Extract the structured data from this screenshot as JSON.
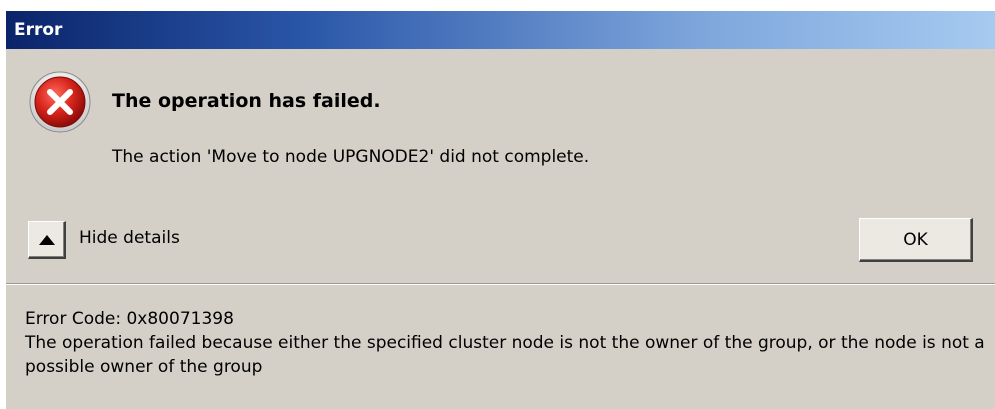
{
  "window": {
    "title": "Error"
  },
  "dialog": {
    "icon": "error-icon",
    "heading": "The operation has failed.",
    "message": "The action 'Move to node UPGNODE2' did not complete."
  },
  "details_toggle": {
    "icon": "triangle-up-icon",
    "label": "Hide details"
  },
  "buttons": {
    "ok_label": "OK"
  },
  "details": {
    "error_code": "Error Code: 0x80071398",
    "description": "The operation failed because either the specified cluster node is not the owner of the group, or the node is not a possible owner of the group"
  },
  "colors": {
    "title_gradient_start": "#0a246a",
    "title_gradient_end": "#a6caf0",
    "dialog_background": "#d4d0c8",
    "error_red": "#c8181a"
  }
}
